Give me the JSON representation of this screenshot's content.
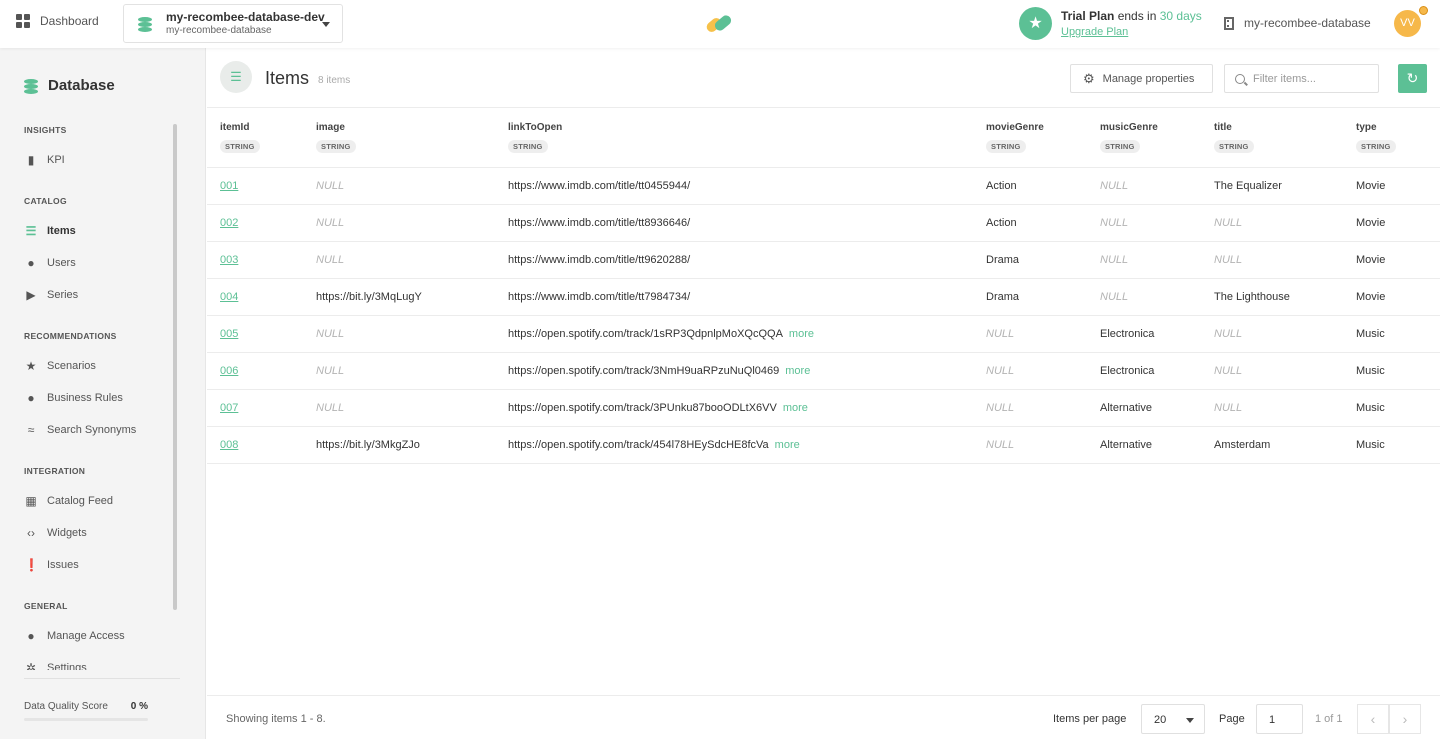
{
  "topbar": {
    "dashboard_label": "Dashboard",
    "database_name": "my-recombee-database-dev",
    "database_sub": "my-recombee-database",
    "trial_prefix": "Trial Plan",
    "trial_mid": " ends in ",
    "trial_days": "30 days",
    "upgrade_label": "Upgrade Plan",
    "instance_name": "my-recombee-database",
    "avatar_initials": "VV"
  },
  "sidebar": {
    "title": "Database",
    "sections": {
      "insights": "INSIGHTS",
      "catalog": "CATALOG",
      "recommendations": "RECOMMENDATIONS",
      "integration": "INTEGRATION",
      "general": "GENERAL"
    },
    "items": {
      "kpi": "KPI",
      "items": "Items",
      "users": "Users",
      "series": "Series",
      "scenarios": "Scenarios",
      "business_rules": "Business Rules",
      "search_synonyms": "Search Synonyms",
      "catalog_feed": "Catalog Feed",
      "widgets": "Widgets",
      "issues": "Issues",
      "manage_access": "Manage Access",
      "settings": "Settings"
    },
    "data_quality_label": "Data Quality Score",
    "data_quality_value": "0 %"
  },
  "main": {
    "title": "Items",
    "count": "8 items",
    "manage_properties": "Manage properties",
    "filter_placeholder": "Filter items...",
    "columns": [
      {
        "label": "itemId",
        "type": "STRING"
      },
      {
        "label": "image",
        "type": "STRING"
      },
      {
        "label": "linkToOpen",
        "type": "STRING"
      },
      {
        "label": "movieGenre",
        "type": "STRING"
      },
      {
        "label": "musicGenre",
        "type": "STRING"
      },
      {
        "label": "title",
        "type": "STRING"
      },
      {
        "label": "type",
        "type": "STRING"
      }
    ],
    "more_label": "more",
    "rows": [
      {
        "itemId": "001",
        "image": "NULL",
        "link": "https://www.imdb.com/title/tt0455944/",
        "more": "",
        "movieGenre": "Action",
        "musicGenre": "NULL",
        "title": "The Equalizer",
        "type": "Movie"
      },
      {
        "itemId": "002",
        "image": "NULL",
        "link": "https://www.imdb.com/title/tt8936646/",
        "more": "",
        "movieGenre": "Action",
        "musicGenre": "NULL",
        "title": "NULL",
        "type": "Movie"
      },
      {
        "itemId": "003",
        "image": "NULL",
        "link": "https://www.imdb.com/title/tt9620288/",
        "more": "",
        "movieGenre": "Drama",
        "musicGenre": "NULL",
        "title": "NULL",
        "type": "Movie"
      },
      {
        "itemId": "004",
        "image": "https://bit.ly/3MqLugY",
        "link": "https://www.imdb.com/title/tt7984734/",
        "more": "",
        "movieGenre": "Drama",
        "musicGenre": "NULL",
        "title": "The Lighthouse",
        "type": "Movie"
      },
      {
        "itemId": "005",
        "image": "NULL",
        "link": "https://open.spotify.com/track/1sRP3QdpnlpMoXQcQQA",
        "more": "more",
        "movieGenre": "NULL",
        "musicGenre": "Electronica",
        "title": "NULL",
        "type": "Music"
      },
      {
        "itemId": "006",
        "image": "NULL",
        "link": "https://open.spotify.com/track/3NmH9uaRPzuNuQl0469",
        "more": "more",
        "movieGenre": "NULL",
        "musicGenre": "Electronica",
        "title": "NULL",
        "type": "Music"
      },
      {
        "itemId": "007",
        "image": "NULL",
        "link": "https://open.spotify.com/track/3PUnku87booODLtX6VV",
        "more": "more",
        "movieGenre": "NULL",
        "musicGenre": "Alternative",
        "title": "NULL",
        "type": "Music"
      },
      {
        "itemId": "008",
        "image": "https://bit.ly/3MkgZJo",
        "link": "https://open.spotify.com/track/454l78HEySdcHE8fcVa",
        "more": "more",
        "movieGenre": "NULL",
        "musicGenre": "Alternative",
        "title": "Amsterdam",
        "type": "Music"
      }
    ]
  },
  "footer": {
    "showing": "Showing items 1 - 8.",
    "items_per_page_label": "Items per page",
    "items_per_page": "20",
    "page_label": "Page",
    "page_value": "1",
    "of_label": "1 of 1",
    "prev_icon": "chevron-left-icon",
    "next_icon": "chevron-right-icon"
  },
  "colors": {
    "accent": "#5cc095",
    "avatar": "#f6b84a"
  }
}
